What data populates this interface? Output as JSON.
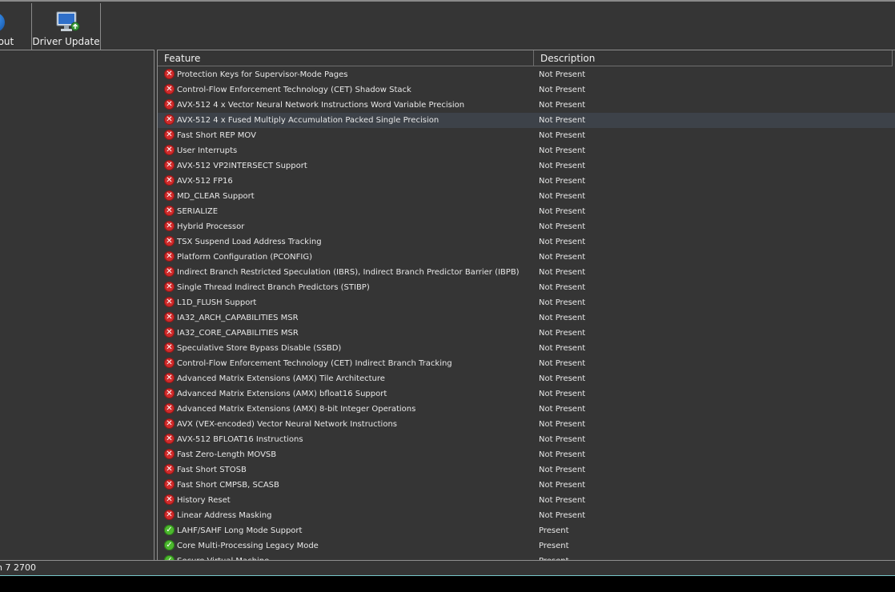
{
  "toolbar": {
    "about_label": "About",
    "driver_update_label": "Driver Update"
  },
  "table": {
    "columns": [
      "Feature",
      "Description"
    ],
    "rows": [
      {
        "feature": "Protection Keys for Supervisor-Mode Pages",
        "description": "Not Present",
        "present": false
      },
      {
        "feature": "Control-Flow Enforcement Technology (CET) Shadow Stack",
        "description": "Not Present",
        "present": false
      },
      {
        "feature": "AVX-512 4 x Vector Neural Network Instructions Word Variable Precision",
        "description": "Not Present",
        "present": false
      },
      {
        "feature": "AVX-512 4 x Fused Multiply Accumulation Packed Single Precision",
        "description": "Not Present",
        "present": false,
        "selected": true
      },
      {
        "feature": "Fast Short REP MOV",
        "description": "Not Present",
        "present": false
      },
      {
        "feature": "User Interrupts",
        "description": "Not Present",
        "present": false
      },
      {
        "feature": "AVX-512 VP2INTERSECT Support",
        "description": "Not Present",
        "present": false
      },
      {
        "feature": "AVX-512 FP16",
        "description": "Not Present",
        "present": false
      },
      {
        "feature": "MD_CLEAR Support",
        "description": "Not Present",
        "present": false
      },
      {
        "feature": "SERIALIZE",
        "description": "Not Present",
        "present": false
      },
      {
        "feature": "Hybrid Processor",
        "description": "Not Present",
        "present": false
      },
      {
        "feature": "TSX Suspend Load Address Tracking",
        "description": "Not Present",
        "present": false
      },
      {
        "feature": "Platform Configuration (PCONFIG)",
        "description": "Not Present",
        "present": false
      },
      {
        "feature": "Indirect Branch Restricted Speculation (IBRS), Indirect Branch Predictor Barrier (IBPB)",
        "description": "Not Present",
        "present": false
      },
      {
        "feature": "Single Thread Indirect Branch Predictors (STIBP)",
        "description": "Not Present",
        "present": false
      },
      {
        "feature": "L1D_FLUSH Support",
        "description": "Not Present",
        "present": false
      },
      {
        "feature": "IA32_ARCH_CAPABILITIES MSR",
        "description": "Not Present",
        "present": false
      },
      {
        "feature": "IA32_CORE_CAPABILITIES MSR",
        "description": "Not Present",
        "present": false
      },
      {
        "feature": "Speculative Store Bypass Disable (SSBD)",
        "description": "Not Present",
        "present": false
      },
      {
        "feature": "Control-Flow Enforcement Technology (CET) Indirect Branch Tracking",
        "description": "Not Present",
        "present": false
      },
      {
        "feature": "Advanced Matrix Extensions (AMX) Tile Architecture",
        "description": "Not Present",
        "present": false
      },
      {
        "feature": "Advanced Matrix Extensions (AMX) bfloat16 Support",
        "description": "Not Present",
        "present": false
      },
      {
        "feature": "Advanced Matrix Extensions (AMX) 8-bit Integer Operations",
        "description": "Not Present",
        "present": false
      },
      {
        "feature": "AVX (VEX-encoded) Vector Neural Network Instructions",
        "description": "Not Present",
        "present": false
      },
      {
        "feature": "AVX-512 BFLOAT16 Instructions",
        "description": "Not Present",
        "present": false
      },
      {
        "feature": "Fast Zero-Length MOVSB",
        "description": "Not Present",
        "present": false
      },
      {
        "feature": "Fast Short STOSB",
        "description": "Not Present",
        "present": false
      },
      {
        "feature": "Fast Short CMPSB, SCASB",
        "description": "Not Present",
        "present": false
      },
      {
        "feature": "History Reset",
        "description": "Not Present",
        "present": false
      },
      {
        "feature": "Linear Address Masking",
        "description": "Not Present",
        "present": false
      },
      {
        "feature": "LAHF/SAHF Long Mode Support",
        "description": "Present",
        "present": true
      },
      {
        "feature": "Core Multi-Processing Legacy Mode",
        "description": "Present",
        "present": true
      },
      {
        "feature": "Secure Virtual Machine",
        "description": "Present",
        "present": true
      }
    ]
  },
  "status": {
    "text": "n 7 2700"
  },
  "colors": {
    "background": "#353535",
    "not_present_icon": "#d12b2b",
    "present_icon": "#4cb82e",
    "selected_row": "#3d4249"
  },
  "icons": {
    "not_present": "red-x-icon",
    "present": "green-check-icon"
  }
}
